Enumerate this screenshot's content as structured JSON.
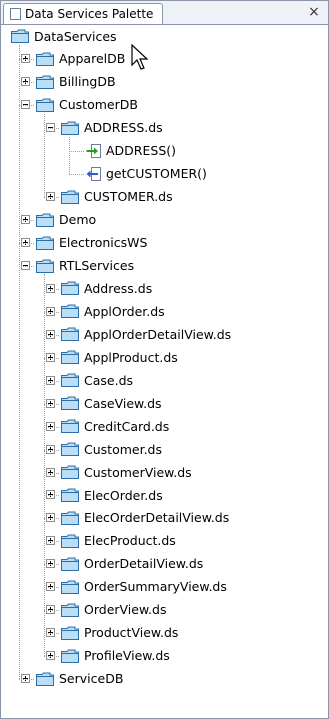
{
  "palette": {
    "title": "Data Services Palette",
    "close_glyph": "×",
    "root": "DataServices",
    "items": [
      {
        "label": "ApparelDB",
        "expanded": false
      },
      {
        "label": "BillingDB",
        "expanded": false
      },
      {
        "label": "CustomerDB",
        "expanded": true,
        "children": [
          {
            "label": "ADDRESS.ds",
            "expanded": true,
            "children": [
              {
                "label": "ADDRESS()",
                "icon": "read-function-icon"
              },
              {
                "label": "getCUSTOMER()",
                "icon": "navigate-function-icon"
              }
            ]
          },
          {
            "label": "CUSTOMER.ds",
            "expanded": false
          }
        ]
      },
      {
        "label": "Demo",
        "expanded": false
      },
      {
        "label": "ElectronicsWS",
        "expanded": false
      },
      {
        "label": "RTLServices",
        "expanded": true,
        "children": [
          {
            "label": "Address.ds",
            "expanded": false
          },
          {
            "label": "ApplOrder.ds",
            "expanded": false
          },
          {
            "label": "ApplOrderDetailView.ds",
            "expanded": false
          },
          {
            "label": "ApplProduct.ds",
            "expanded": false
          },
          {
            "label": "Case.ds",
            "expanded": false
          },
          {
            "label": "CaseView.ds",
            "expanded": false
          },
          {
            "label": "CreditCard.ds",
            "expanded": false
          },
          {
            "label": "Customer.ds",
            "expanded": false
          },
          {
            "label": "CustomerView.ds",
            "expanded": false
          },
          {
            "label": "ElecOrder.ds",
            "expanded": false
          },
          {
            "label": "ElecOrderDetailView.ds",
            "expanded": false
          },
          {
            "label": "ElecProduct.ds",
            "expanded": false
          },
          {
            "label": "OrderDetailView.ds",
            "expanded": false
          },
          {
            "label": "OrderSummaryView.ds",
            "expanded": false
          },
          {
            "label": "OrderView.ds",
            "expanded": false
          },
          {
            "label": "ProductView.ds",
            "expanded": false
          },
          {
            "label": "ProfileView.ds",
            "expanded": false
          }
        ]
      },
      {
        "label": "ServiceDB",
        "expanded": false
      }
    ]
  },
  "colors": {
    "folder_fill": "#b9def5",
    "folder_stroke": "#2c6fa8",
    "border": "#8a96a8",
    "arrow_green": "#20a020",
    "arrow_blue": "#2a5fc4"
  }
}
